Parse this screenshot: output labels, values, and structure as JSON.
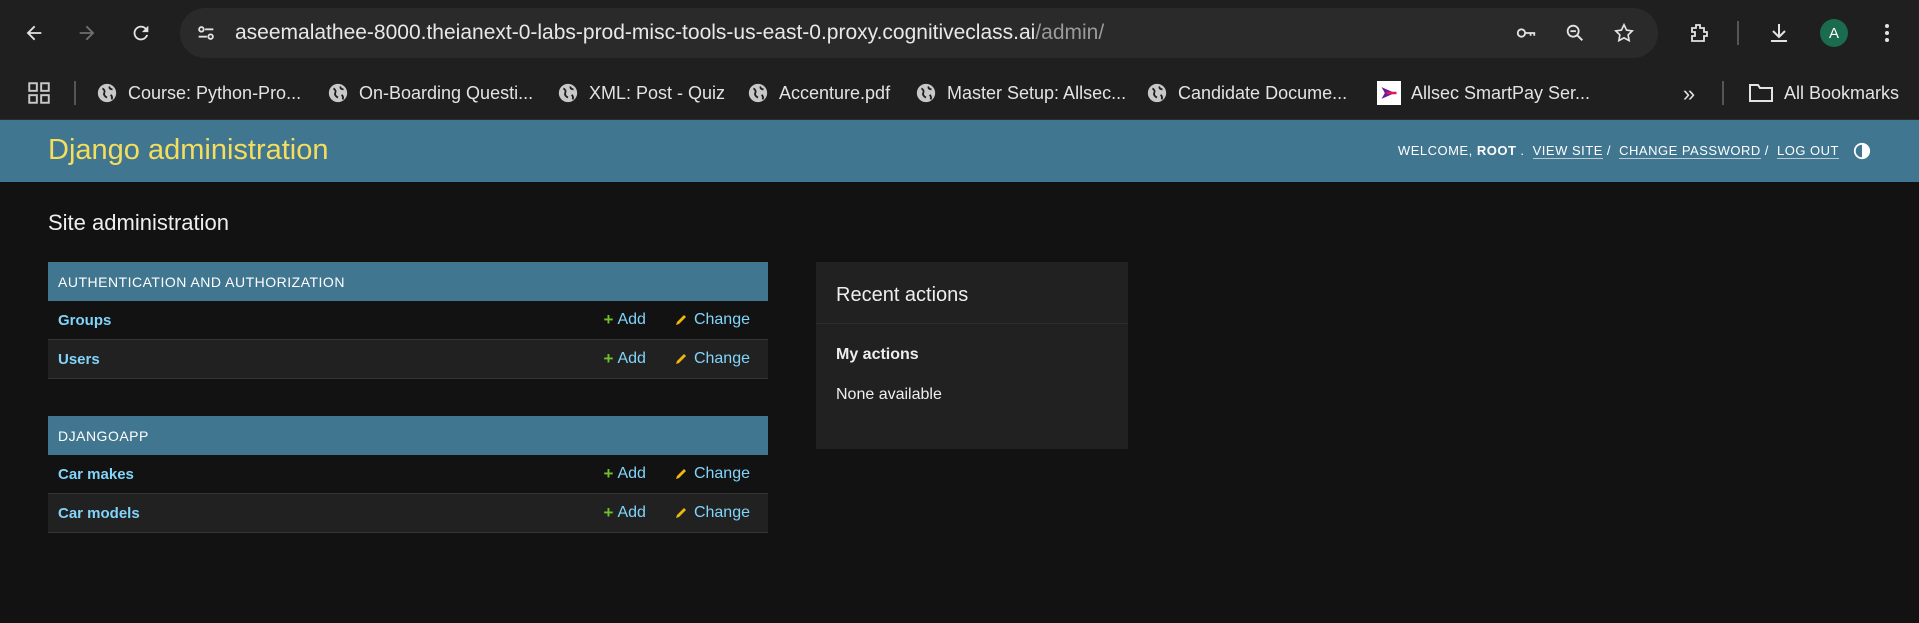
{
  "browser": {
    "url_host": "aseemalathee-8000.theianext-0-labs-prod-misc-tools-us-east-0.proxy.cognitiveclass.ai",
    "url_path": "/admin/",
    "avatar_letter": "A",
    "bookmarks": [
      {
        "label": "Course: Python-Pro...",
        "icon": "globe-icon"
      },
      {
        "label": "On-Boarding Questi...",
        "icon": "globe-icon"
      },
      {
        "label": "XML: Post - Quiz",
        "icon": "globe-icon"
      },
      {
        "label": "Accenture.pdf",
        "icon": "globe-icon"
      },
      {
        "label": "Master Setup: Allsec...",
        "icon": "globe-icon"
      },
      {
        "label": "Candidate Docume...",
        "icon": "globe-icon"
      },
      {
        "label": "Allsec SmartPay Ser...",
        "icon": "allsec-logo-icon"
      }
    ],
    "more_bookmarks": "»",
    "all_bookmarks": "All Bookmarks"
  },
  "header": {
    "brand": "Django administration",
    "welcome": "Welcome, ",
    "username": "root",
    "view_site": "View site",
    "change_password": "Change password",
    "log_out": "Log out"
  },
  "page": {
    "title": "Site administration"
  },
  "apps": [
    {
      "caption": "Authentication and Authorization",
      "models": [
        {
          "name": "Groups",
          "add": "Add",
          "change": "Change"
        },
        {
          "name": "Users",
          "add": "Add",
          "change": "Change"
        }
      ]
    },
    {
      "caption": "Djangoapp",
      "models": [
        {
          "name": "Car makes",
          "add": "Add",
          "change": "Change"
        },
        {
          "name": "Car models",
          "add": "Add",
          "change": "Change"
        }
      ]
    }
  ],
  "recent": {
    "title": "Recent actions",
    "subtitle": "My actions",
    "empty": "None available"
  },
  "colors": {
    "header_bg": "#417690",
    "brand": "#f5dd5d",
    "link": "#81d4fa",
    "add_plus": "#70bf2b",
    "body_bg": "#121212"
  }
}
